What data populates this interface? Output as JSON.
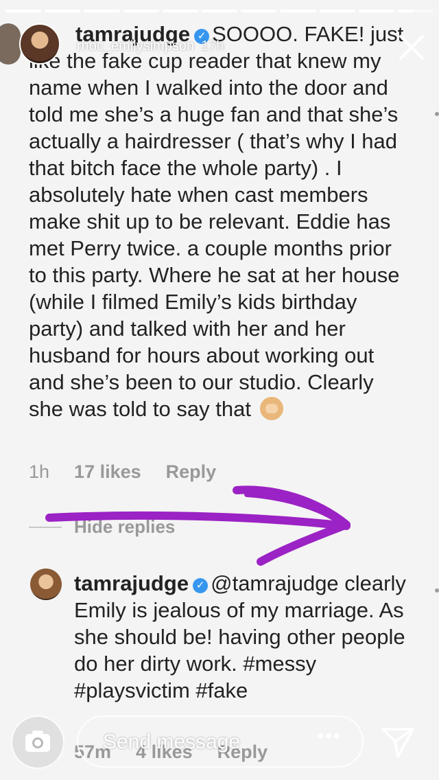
{
  "story": {
    "progress_segments": [
      1,
      1,
      1,
      1,
      1,
      1,
      1,
      1,
      1,
      1,
      0.45
    ],
    "username": "rhoc_emilysimpson",
    "time": "17h"
  },
  "comment": {
    "username": "tamrajudge",
    "text_line_1": "SOOOO. FAKE!  just",
    "text_rest": "like the fake cup reader that knew my name when I walked into the door and told me she’s a huge fan and that she’s actually  a hairdresser ( that’s why I had that bitch face the whole party) .  I absolutely hate when cast members make shit up to be relevant.  Eddie has met Perry twice.  a couple months prior to this party.  Where he sat at her house (while I filmed Emily’s kids birthday party) and talked with her and her husband  for hours about working out and she’s been to our studio.  Clearly she was told to say that",
    "time": "1h",
    "likes": "17 likes",
    "reply_label": "Reply",
    "hide_replies": "Hide replies"
  },
  "reply": {
    "username": "tamrajudge",
    "mention": "@tamrajudge",
    "text": "clearly Emily is jealous of my marriage.  As she should be! having other people do her dirty work. #messy #playsvictim #fake",
    "time": "57m",
    "likes": "4 likes",
    "reply_label": "Reply"
  },
  "bottom_bar": {
    "message_placeholder": "Send message",
    "more": "•••"
  },
  "colors": {
    "arrow": "#9b22c4",
    "verified": "#3797f0"
  }
}
